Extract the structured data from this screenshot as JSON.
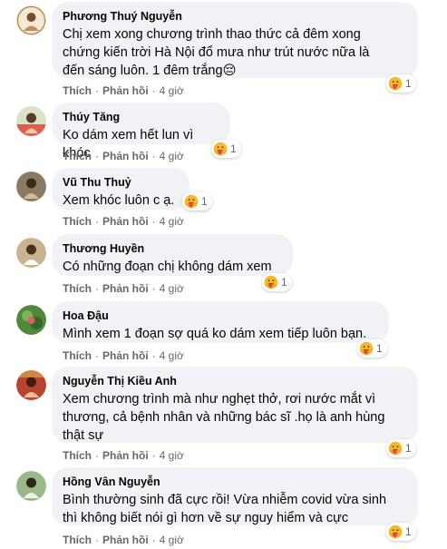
{
  "comments": [
    {
      "author": "Phương Thuý Nguyễn",
      "text": "Chị xem xong chương trình thao thức cả đêm xong\nchứng kiến trời Hà Nội đổ mưa như trút nước nữa là\nđến sáng luôn. 1 đêm trắng😔",
      "like_label": "Thích",
      "reply_label": "Phản hồi",
      "time": "4 giờ",
      "reaction": {
        "emoji": "care-emoji",
        "count": "1"
      }
    },
    {
      "author": "Thúy Tăng",
      "text": "Ko dám xem hết lun vì khóc",
      "like_label": "Thích",
      "reply_label": "Phản hồi",
      "time": "4 giờ",
      "reaction": {
        "emoji": "care-emoji",
        "count": "1"
      }
    },
    {
      "author": "Vũ Thu Thuỷ",
      "text": "Xem khóc luôn c ạ.",
      "like_label": "Thích",
      "reply_label": "Phản hồi",
      "time": "4 giờ",
      "reaction": {
        "emoji": "care-emoji",
        "count": "1"
      }
    },
    {
      "author": "Thương Huyền",
      "text": "Có những đoạn chị không dám xem",
      "like_label": "Thích",
      "reply_label": "Phản hồi",
      "time": "4 giờ",
      "reaction": {
        "emoji": "care-emoji",
        "count": "1"
      }
    },
    {
      "author": "Hoa Đậu",
      "text": "Mình xem 1 đoạn sợ quá ko dám xem tiếp luôn bạn.",
      "like_label": "Thích",
      "reply_label": "Phản hồi",
      "time": "4 giờ",
      "reaction": {
        "emoji": "care-emoji",
        "count": "1"
      }
    },
    {
      "author": "Nguyễn Thị Kiều Anh",
      "text": "Xem chương trình mà như nghẹt thở, rơi nước mắt vì\nthương, cả bệnh nhân và những bác sĩ .họ là anh hùng\nthật sự",
      "like_label": "Thích",
      "reply_label": "Phản hồi",
      "time": "4 giờ",
      "reaction": {
        "emoji": "care-emoji",
        "count": "1"
      }
    },
    {
      "author": "Hồng Vân Nguyễn",
      "text": "Bình thường sinh đã cực rồi! Vừa nhiễm covid vừa sinh\nthì không biết nói gì hơn về sự nguy hiểm và cực",
      "like_label": "Thích",
      "reply_label": "Phản hồi",
      "time": "4 giờ",
      "reaction": {
        "emoji": "care-emoji",
        "count": "1"
      }
    }
  ],
  "colors": {
    "bubble": "#f0f2f5",
    "text": "#050505",
    "meta": "#65676b",
    "care_yellow": "#f7b928",
    "care_heart": "#f33e58"
  }
}
